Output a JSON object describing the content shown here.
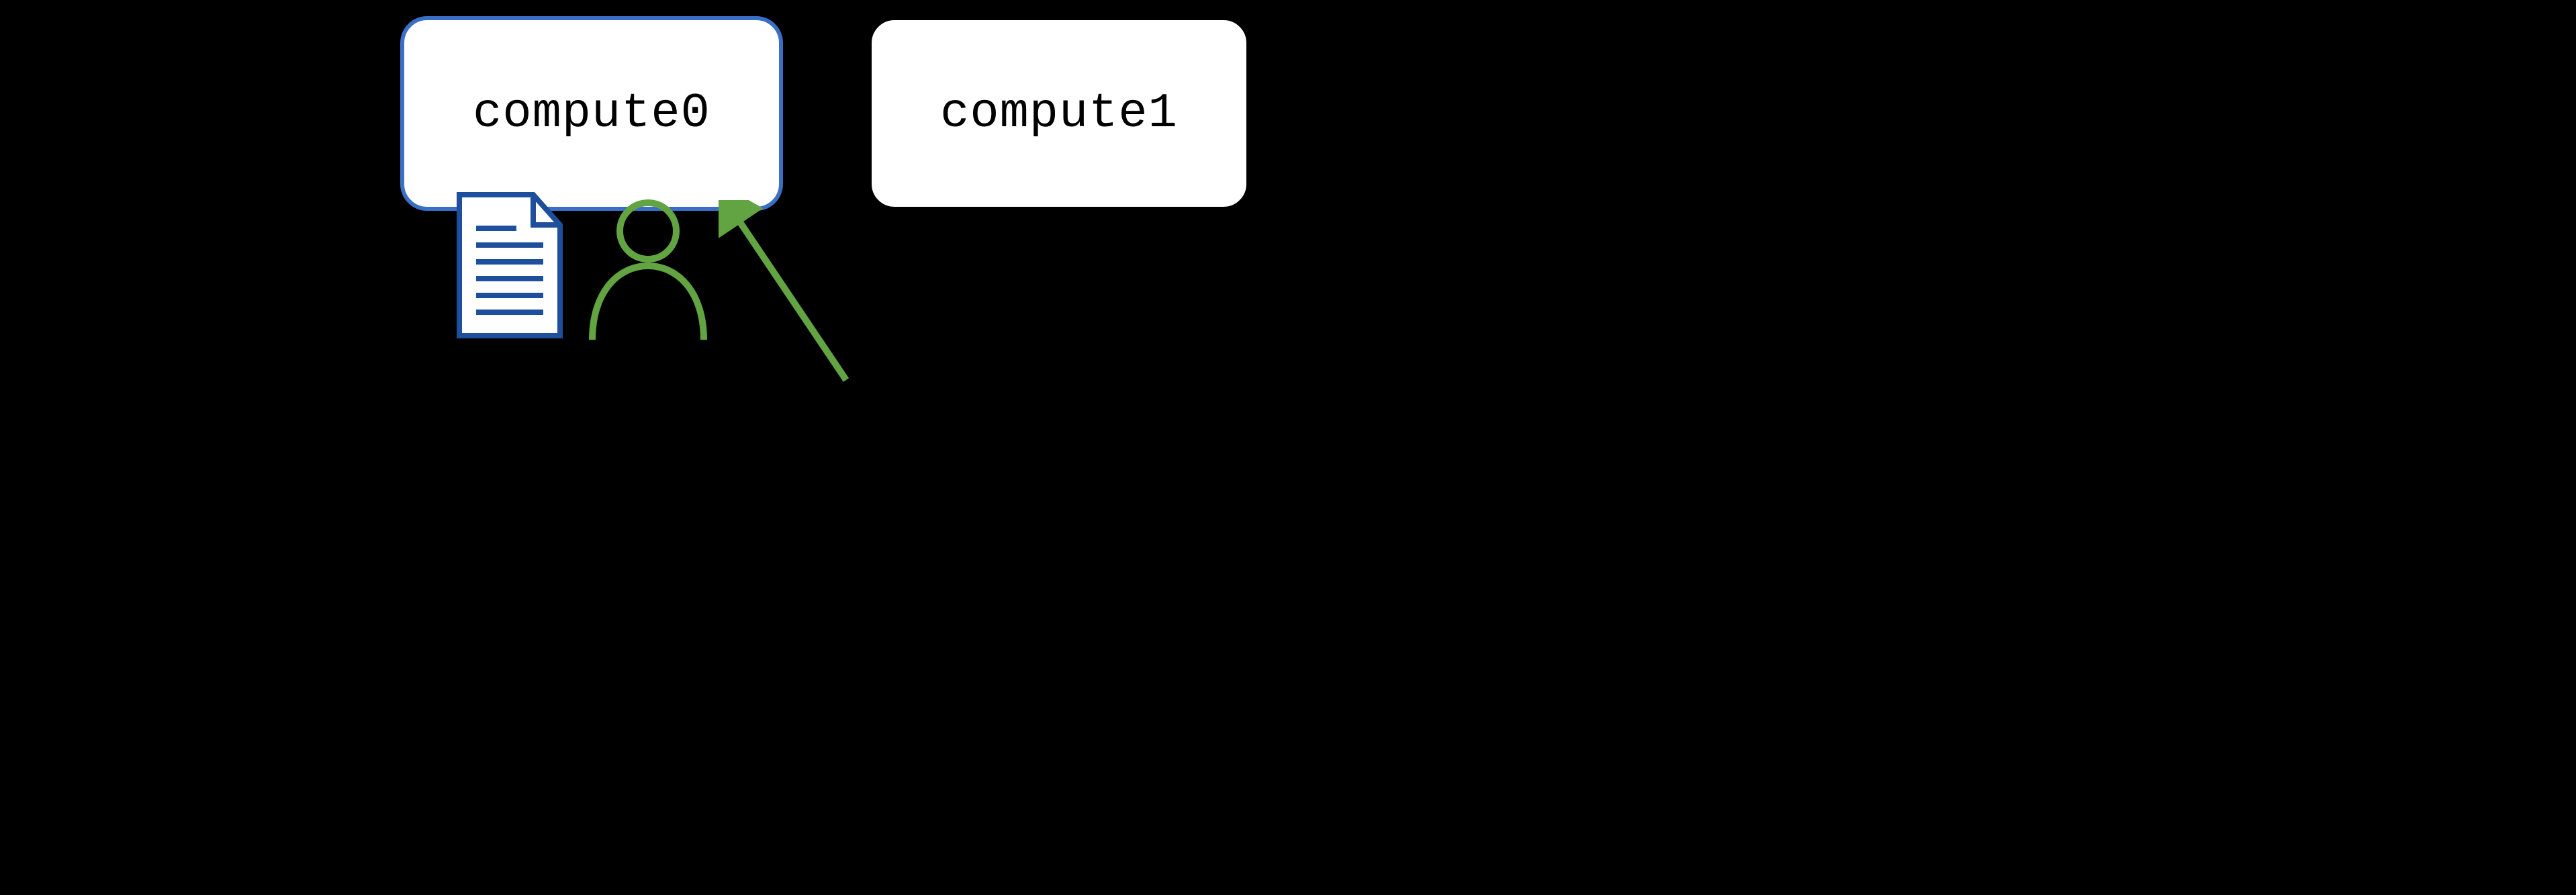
{
  "nodes": {
    "compute0": {
      "label": "compute0",
      "highlighted": true,
      "highlight_color": "#3a6fc6"
    },
    "compute1": {
      "label": "compute1",
      "highlighted": false
    }
  },
  "icons": {
    "document": {
      "name": "document-icon",
      "color": "#1d4f9c"
    },
    "person": {
      "name": "person-icon",
      "color": "#62a342"
    }
  },
  "arrow": {
    "color": "#62a342",
    "direction": "up-left",
    "target": "compute0"
  }
}
